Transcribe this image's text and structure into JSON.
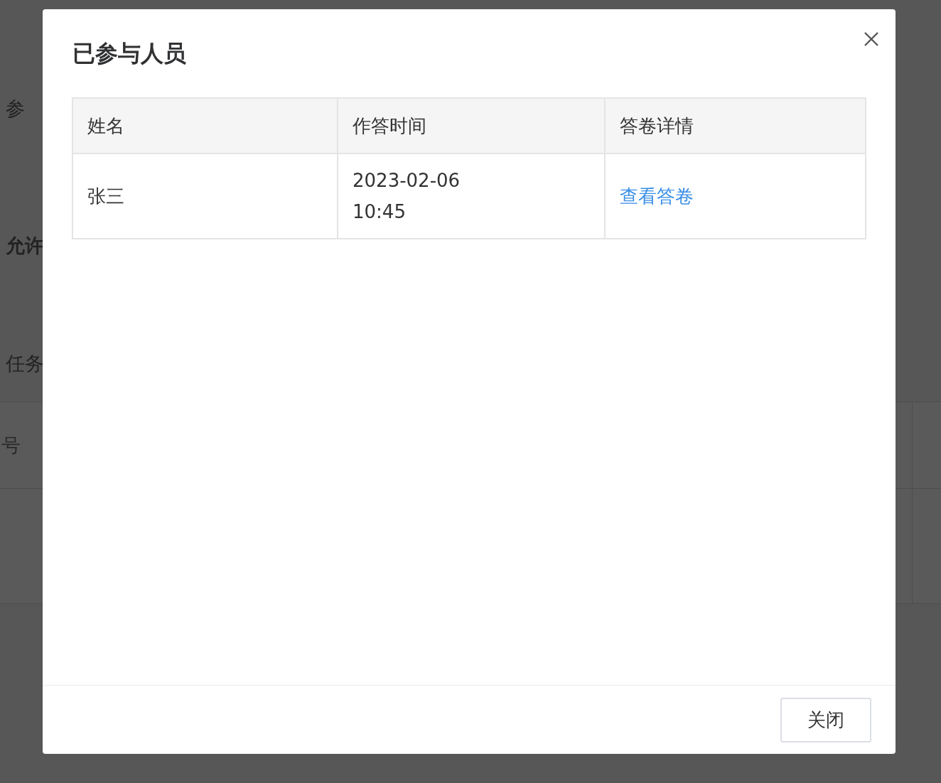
{
  "background": {
    "labels": [
      {
        "text": "参",
        "bold": false
      },
      {
        "text": "允许",
        "bold": true
      },
      {
        "text": "任务",
        "bold": false
      }
    ],
    "table_header": "号"
  },
  "dialog": {
    "title": "已参与人员",
    "table": {
      "columns": [
        "姓名",
        "作答时间",
        "答卷详情"
      ],
      "rows": [
        {
          "name": "张三",
          "time": "2023-02-06 10:45",
          "detail": "查看答卷"
        }
      ]
    },
    "buttons": [
      "关闭"
    ]
  }
}
